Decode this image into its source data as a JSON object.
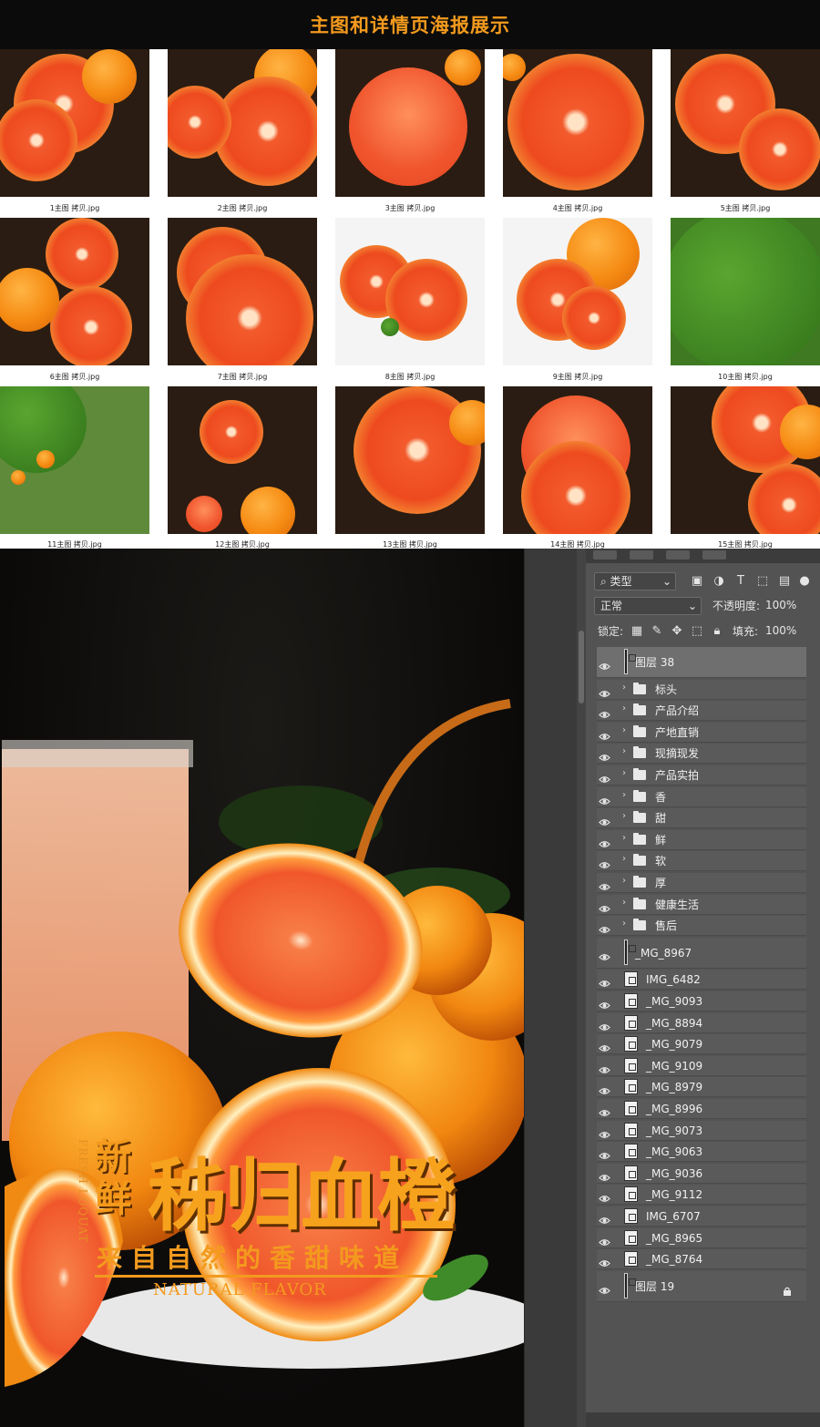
{
  "banner": {
    "title": "主图和详情页海报展示"
  },
  "thumbnails": [
    {
      "caption": "1主图 拷贝.jpg"
    },
    {
      "caption": "2主图 拷贝.jpg"
    },
    {
      "caption": "3主图 拷贝.jpg"
    },
    {
      "caption": "4主图 拷贝.jpg"
    },
    {
      "caption": "5主图 拷贝.jpg"
    },
    {
      "caption": "6主图 拷贝.jpg"
    },
    {
      "caption": "7主图 拷贝.jpg"
    },
    {
      "caption": "8主图 拷贝.jpg"
    },
    {
      "caption": "9主图 拷贝.jpg"
    },
    {
      "caption": "10主图 拷贝.jpg"
    },
    {
      "caption": "11主图 拷贝.jpg"
    },
    {
      "caption": "12主图 拷贝.jpg"
    },
    {
      "caption": "13主图 拷贝.jpg"
    },
    {
      "caption": "14主图 拷贝.jpg"
    },
    {
      "caption": "15主图 拷贝.jpg"
    }
  ],
  "poster": {
    "side_text": "FRESH LOQUAT",
    "fresh": "新鲜",
    "title": "秭归血橙",
    "subtitle": "来自自然的香甜味道",
    "english": "NATURAL FLAVOR"
  },
  "layers_panel": {
    "filter_kind": "类型",
    "blend_mode": "正常",
    "opacity_label": "不透明度:",
    "opacity_value": "100%",
    "lock_label": "锁定:",
    "fill_label": "填充:",
    "fill_value": "100%",
    "layers": [
      {
        "name": "图层 38",
        "kind": "pixel",
        "selected": true
      },
      {
        "name": "标头",
        "kind": "group"
      },
      {
        "name": "产品介绍",
        "kind": "group"
      },
      {
        "name": "产地直销",
        "kind": "group"
      },
      {
        "name": "现摘现发",
        "kind": "group"
      },
      {
        "name": "产品实拍",
        "kind": "group"
      },
      {
        "name": "香",
        "kind": "group"
      },
      {
        "name": "甜",
        "kind": "group"
      },
      {
        "name": "鲜",
        "kind": "group"
      },
      {
        "name": "软",
        "kind": "group"
      },
      {
        "name": "厚",
        "kind": "group"
      },
      {
        "name": "健康生活",
        "kind": "group"
      },
      {
        "name": "售后",
        "kind": "group"
      },
      {
        "name": "_MG_8967",
        "kind": "pixel"
      },
      {
        "name": "IMG_6482",
        "kind": "smart"
      },
      {
        "name": "_MG_9093",
        "kind": "smart"
      },
      {
        "name": "_MG_8894",
        "kind": "smart"
      },
      {
        "name": "_MG_9079",
        "kind": "smart"
      },
      {
        "name": "_MG_9109",
        "kind": "smart"
      },
      {
        "name": "_MG_8979",
        "kind": "smart"
      },
      {
        "name": "_MG_8996",
        "kind": "smart"
      },
      {
        "name": "_MG_9073",
        "kind": "smart"
      },
      {
        "name": "_MG_9063",
        "kind": "smart"
      },
      {
        "name": "_MG_9036",
        "kind": "smart"
      },
      {
        "name": "_MG_9112",
        "kind": "smart"
      },
      {
        "name": "IMG_6707",
        "kind": "smart"
      },
      {
        "name": "_MG_8965",
        "kind": "smart"
      },
      {
        "name": "_MG_8764",
        "kind": "smart"
      },
      {
        "name": "图层 19",
        "kind": "pixel",
        "locked": true
      }
    ]
  },
  "colors": {
    "accent": "#f39a1e",
    "panel_bg": "#535353",
    "layer_bg": "#5a5a5a"
  }
}
